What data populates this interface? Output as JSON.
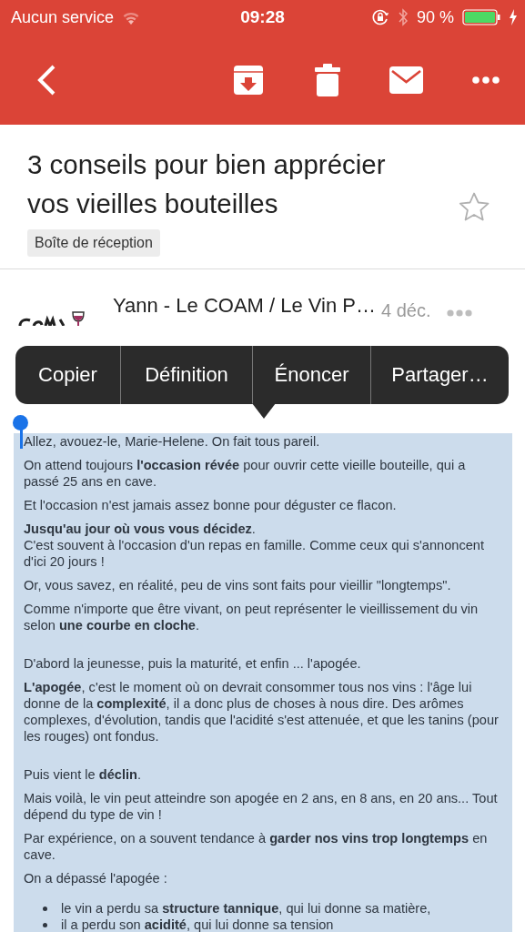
{
  "status_bar": {
    "carrier": "Aucun service",
    "time": "09:28",
    "battery": "90 %"
  },
  "message": {
    "subject": "3 conseils pour bien apprécier vos vieilles bouteilles",
    "labels": [
      "Boîte de réception"
    ],
    "starred": false,
    "sender": "Yann - Le COAM / Le Vin P…",
    "date": "4 déc."
  },
  "context_menu": {
    "items": [
      "Copier",
      "Définition",
      "Énoncer",
      "Partager…"
    ]
  },
  "body": {
    "selected": true,
    "blocks": [
      {
        "kind": "paragraph",
        "text": "Allez, avouez-le, Marie-Helene. On fait tous pareil."
      },
      {
        "kind": "paragraph",
        "text": "On attend toujours **l'occasion révée** pour ouvrir cette vieille bouteille, qui a passé 25 ans en cave."
      },
      {
        "kind": "paragraph",
        "text": "Et l'occasion n'est jamais assez bonne pour déguster ce flacon."
      },
      {
        "kind": "paragraph",
        "text": "**Jusqu'au jour où vous vous décidez**.\nC'est souvent à l'occasion d'un repas en famille. Comme ceux qui s'annoncent d'ici 20 jours !"
      },
      {
        "kind": "paragraph",
        "text": "Or, vous savez, en réalité, peu de vins sont faits pour vieillir \"longtemps\"."
      },
      {
        "kind": "paragraph",
        "text": "Comme n'importe que être vivant, on peut représenter le vieillissement du vin selon **une courbe en cloche**."
      },
      {
        "kind": "paragraph",
        "gap_before": true,
        "text": "D'abord la jeunesse, puis la maturité, et enfin ... l'apogée."
      },
      {
        "kind": "paragraph",
        "text": "**L'apogée**, c'est le moment où on devrait consommer tous nos vins : l'âge lui donne de la **complexité**, il a donc plus de choses à nous dire. Des arômes complexes, d'évolution, tandis que l'acidité s'est attenuée, et que les tanins (pour les rouges) ont fondus."
      },
      {
        "kind": "paragraph",
        "gap_before": true,
        "text": "Puis vient le **déclin**."
      },
      {
        "kind": "paragraph",
        "text": "Mais voilà, le vin peut atteindre son apogée en 2 ans, en 8 ans, en 20 ans... Tout dépend du type de vin !"
      },
      {
        "kind": "paragraph",
        "text": "Par expérience, on a souvent tendance à **garder nos vins trop longtemps** en cave."
      },
      {
        "kind": "paragraph",
        "text": "On a dépassé l'apogée :"
      },
      {
        "kind": "list",
        "items": [
          "le vin a perdu sa **structure tannique**, qui lui donne sa matière,",
          "il a perdu son **acidité**, qui lui donne sa tension"
        ]
      }
    ]
  }
}
